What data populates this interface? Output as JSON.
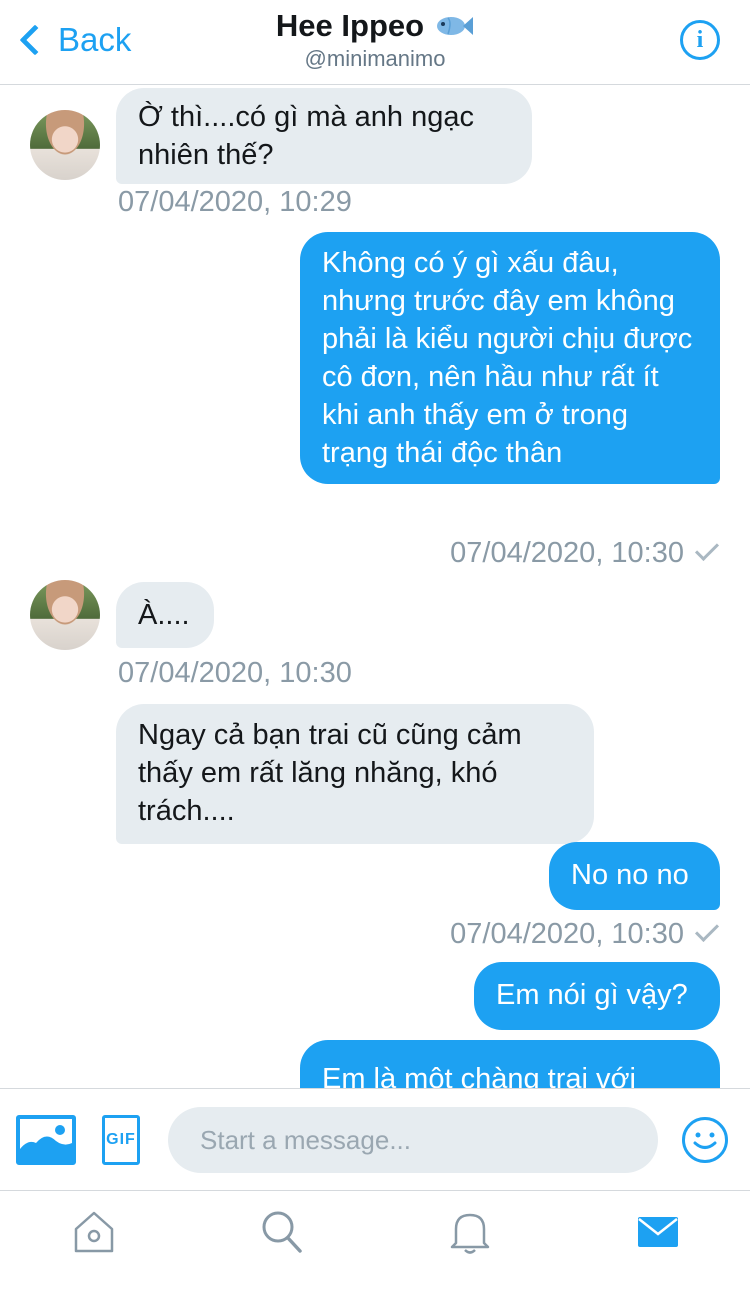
{
  "header": {
    "back_label": "Back",
    "title": "Hee Ippeo",
    "handle": "@minimanimo"
  },
  "messages": [
    {
      "dir": "in",
      "text": "Ờ thì....có gì mà anh ngạc nhiên thế?",
      "time": "07/04/2020, 10:29"
    },
    {
      "dir": "out",
      "text": "Không có ý gì xấu đâu, nhưng trước đây em không phải là kiểu người chịu được cô đơn, nên hầu như rất ít khi anh thấy em ở trong trạng thái độc thân",
      "time": "07/04/2020, 10:30"
    },
    {
      "dir": "in",
      "text": "À....",
      "time": "07/04/2020, 10:30"
    },
    {
      "dir": "in",
      "text": "Ngay cả bạn trai cũ cũng cảm thấy em rất lăng nhăng, khó trách....",
      "time": ""
    },
    {
      "dir": "out",
      "text": "No no no",
      "time": "07/04/2020, 10:30"
    },
    {
      "dir": "out",
      "text": "Em nói gì vậy?",
      "time": ""
    },
    {
      "dir": "out",
      "text": "Em là một chàng trai với",
      "time": ""
    }
  ],
  "composer": {
    "placeholder": "Start a message...",
    "gif_label": "GIF"
  },
  "colors": {
    "accent": "#1da1f2",
    "incoming_bubble": "#e6ecf0",
    "timestamp": "#8a9aa6"
  },
  "tabs": [
    {
      "icon": "home-icon",
      "active": false
    },
    {
      "icon": "search-icon",
      "active": false
    },
    {
      "icon": "bell-icon",
      "active": false
    },
    {
      "icon": "envelope-icon",
      "active": true
    }
  ]
}
